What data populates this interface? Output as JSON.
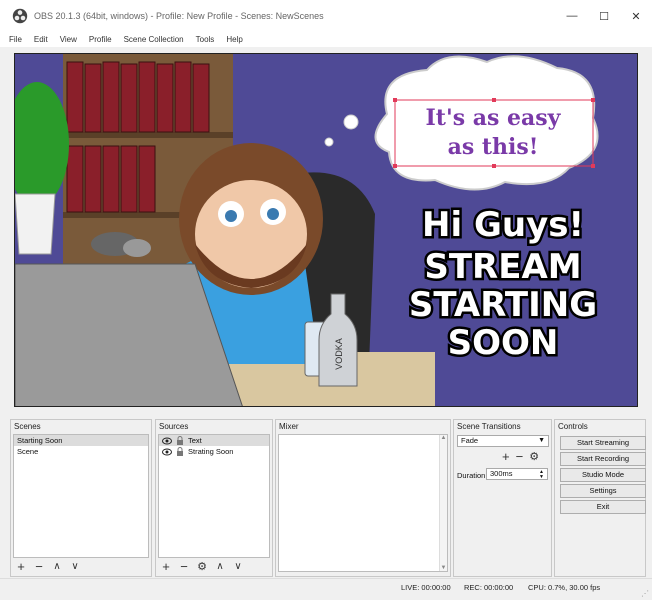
{
  "window": {
    "title": "OBS 20.1.3 (64bit, windows) - Profile: New Profile - Scenes: NewScenes",
    "controls": {
      "minimize": "—",
      "maximize": "☐",
      "close": "✕"
    }
  },
  "menu": [
    "File",
    "Edit",
    "View",
    "Profile",
    "Scene Collection",
    "Tools",
    "Help"
  ],
  "preview": {
    "bubble_line1": "It's as easy",
    "bubble_line2": "as this!",
    "headline_lines": [
      "Hi Guys!",
      "STREAM",
      "STARTING",
      "SOON"
    ],
    "bottle_label": "VODKA"
  },
  "scenes": {
    "title": "Scenes",
    "items": [
      "Starting Soon",
      "Scene"
    ],
    "selected": 0
  },
  "sources": {
    "title": "Sources",
    "items": [
      "Text",
      "Strating Soon"
    ],
    "selected": 0
  },
  "mixer": {
    "title": "Mixer"
  },
  "transitions": {
    "title": "Scene Transitions",
    "selected": "Fade",
    "duration_label": "Duration",
    "duration_value": "300ms"
  },
  "controls": {
    "title": "Controls",
    "start_streaming": "Start Streaming",
    "start_recording": "Start Recording",
    "studio_mode": "Studio Mode",
    "settings": "Settings",
    "exit": "Exit"
  },
  "status": {
    "live": "LIVE: 00:00:00",
    "rec": "REC: 00:00:00",
    "cpu": "CPU: 0.7%, 30.00 fps"
  },
  "colors": {
    "background": "#4f4a96",
    "headline_fill": "#ffffff",
    "bubble_text": "#7a3aa8",
    "selection": "#e23a5a"
  }
}
